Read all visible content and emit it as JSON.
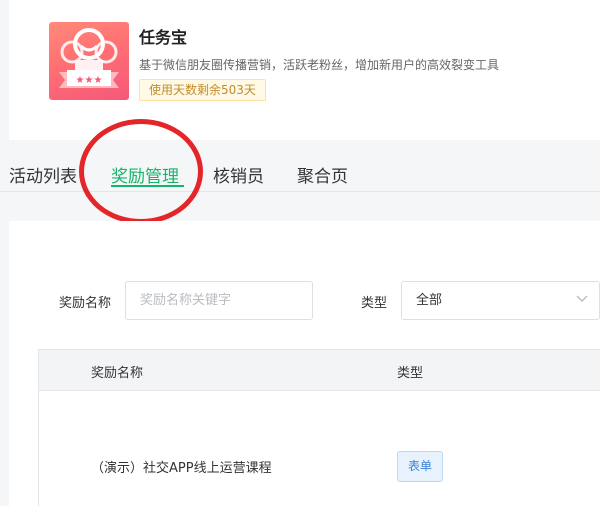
{
  "app": {
    "name": "任务宝",
    "description": "基于微信朋友圈传播营销，活跃老粉丝，增加新用户的高效裂变工具",
    "badge": "使用天数剩余503天",
    "accent_color": "#15b56a"
  },
  "tabs": [
    {
      "label": "活动列表",
      "active": false
    },
    {
      "label": "奖励管理",
      "active": true
    },
    {
      "label": "核销员",
      "active": false
    },
    {
      "label": "聚合页",
      "active": false
    }
  ],
  "filters": {
    "name_label": "奖励名称",
    "name_placeholder": "奖励名称关键字",
    "type_label": "类型",
    "type_value": "全部"
  },
  "table": {
    "columns": [
      "奖励名称",
      "类型"
    ],
    "rows": [
      {
        "name": "（演示）社交APP线上运营课程",
        "type": "表单"
      }
    ]
  }
}
